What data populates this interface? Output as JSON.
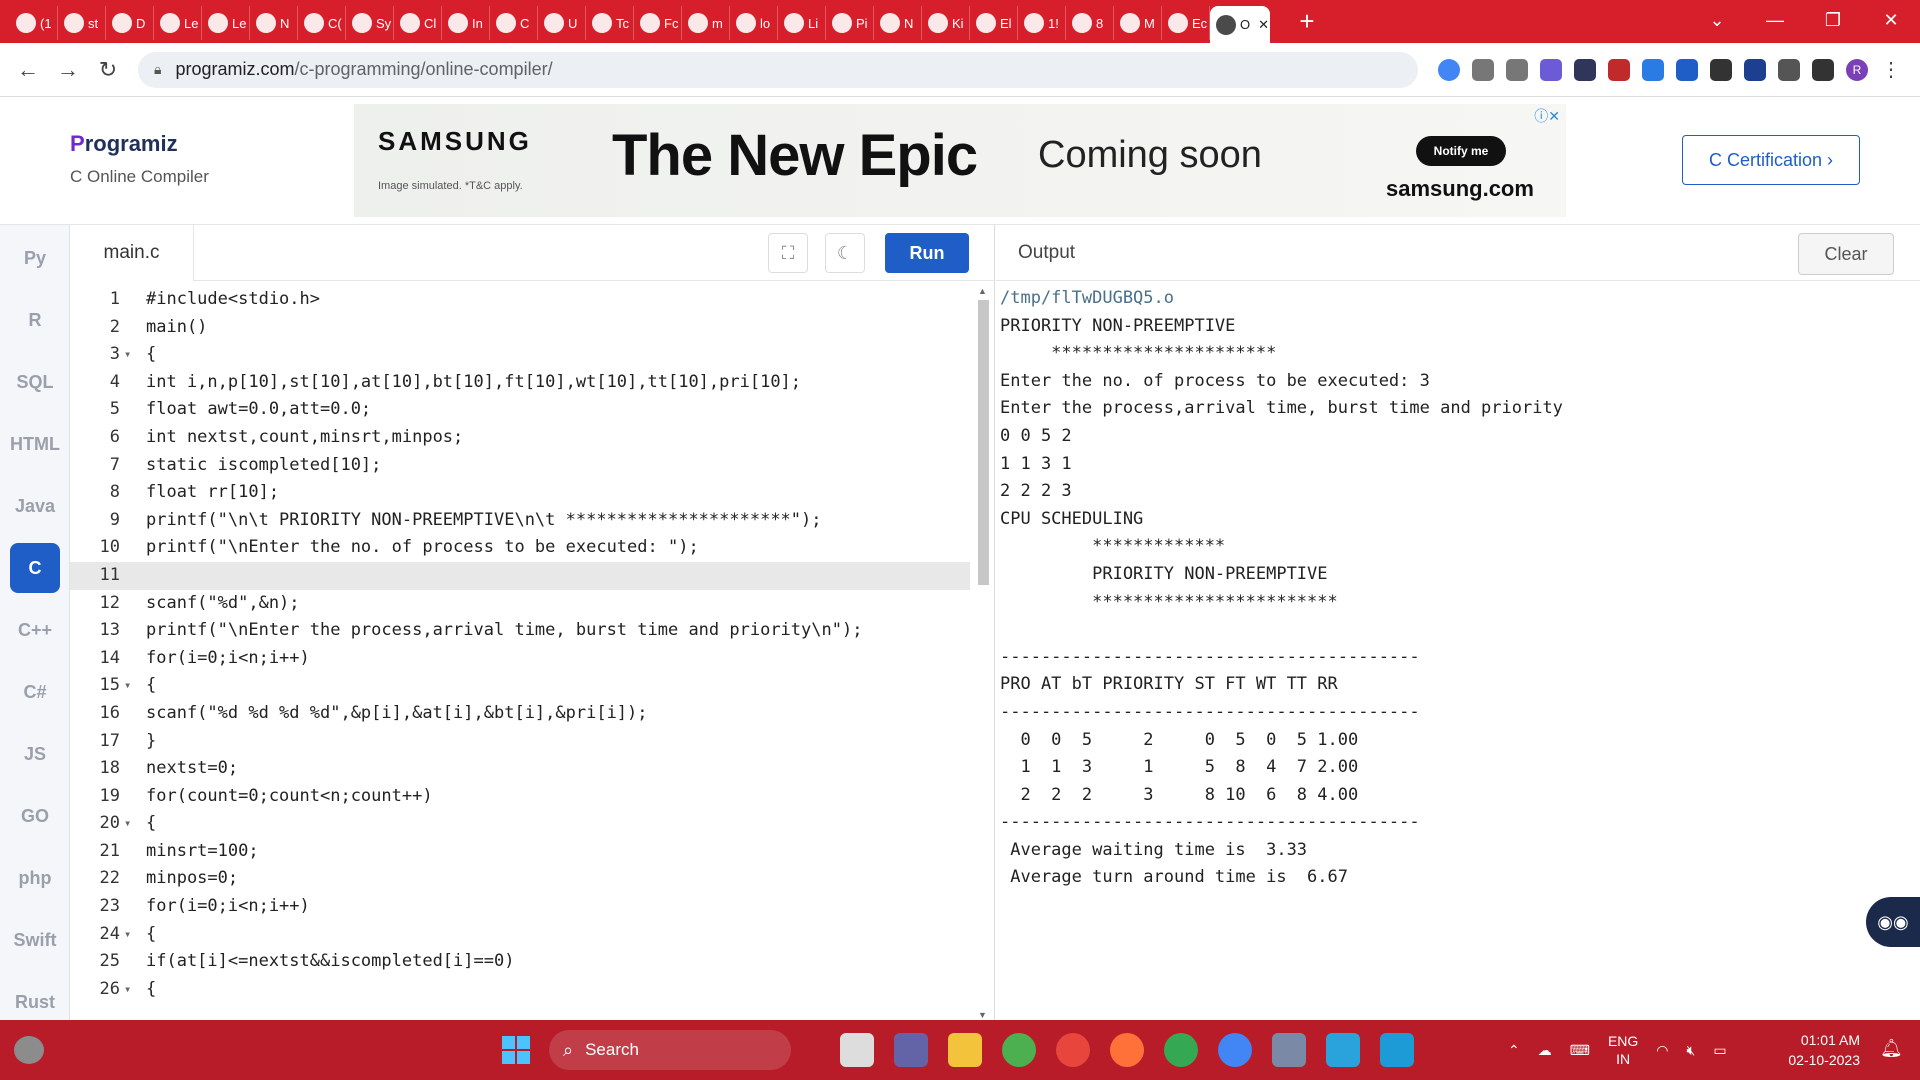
{
  "browser": {
    "tabs": [
      "(1",
      "st",
      "D",
      "Le",
      "Le",
      "N",
      "C(",
      "Sy",
      "Cl",
      "In",
      "C",
      "U",
      "Tc",
      "Fc",
      "m",
      "lo",
      "Li",
      "Pi",
      "N",
      "Ki",
      "El",
      "1!",
      "8",
      "M",
      "Ec",
      "O"
    ],
    "active_tab_close": "✕",
    "url_domain": "programiz.com",
    "url_path": "/c-programming/online-compiler/",
    "profile_initial": "R"
  },
  "header": {
    "logo_name": "rogramiz",
    "logo_p": "P",
    "logo_subtitle": "C Online Compiler",
    "certification_button": "C Certification ›"
  },
  "ad": {
    "brand": "SAMSUNG",
    "fine_print": "Image simulated. *T&C apply.",
    "headline": "The New Epic",
    "tagline": "Coming soon",
    "cta": "Notify me",
    "site": "samsung.com",
    "adchoices": "ⓘ✕"
  },
  "rail": {
    "items": [
      "Py",
      "R",
      "SQL",
      "HTML",
      "Java",
      "C",
      "C++",
      "C#",
      "JS",
      "GO",
      "php",
      "Swift",
      "Rust"
    ]
  },
  "editor": {
    "file_name": "main.c",
    "run_label": "Run",
    "lines": [
      {
        "n": "1",
        "fold": "",
        "text": "#include<stdio.h>"
      },
      {
        "n": "2",
        "fold": "",
        "text": "main()"
      },
      {
        "n": "3",
        "fold": "▾",
        "text": "{"
      },
      {
        "n": "4",
        "fold": "",
        "text": "int i,n,p[10],st[10],at[10],bt[10],ft[10],wt[10],tt[10],pri[10];"
      },
      {
        "n": "5",
        "fold": "",
        "text": "float awt=0.0,att=0.0;"
      },
      {
        "n": "6",
        "fold": "",
        "text": "int nextst,count,minsrt,minpos;"
      },
      {
        "n": "7",
        "fold": "",
        "text": "static iscompleted[10];"
      },
      {
        "n": "8",
        "fold": "",
        "text": "float rr[10];"
      },
      {
        "n": "9",
        "fold": "",
        "text": "printf(\"\\n\\t PRIORITY NON-PREEMPTIVE\\n\\t **********************\");"
      },
      {
        "n": "10",
        "fold": "",
        "text": "printf(\"\\nEnter the no. of process to be executed: \");"
      },
      {
        "n": "11",
        "fold": "",
        "text": ""
      },
      {
        "n": "12",
        "fold": "",
        "text": "scanf(\"%d\",&n);"
      },
      {
        "n": "13",
        "fold": "",
        "text": "printf(\"\\nEnter the process,arrival time, burst time and priority\\n\");"
      },
      {
        "n": "14",
        "fold": "",
        "text": "for(i=0;i<n;i++)"
      },
      {
        "n": "15",
        "fold": "▾",
        "text": "{"
      },
      {
        "n": "16",
        "fold": "",
        "text": "scanf(\"%d %d %d %d\",&p[i],&at[i],&bt[i],&pri[i]);"
      },
      {
        "n": "17",
        "fold": "",
        "text": "}"
      },
      {
        "n": "18",
        "fold": "",
        "text": "nextst=0;"
      },
      {
        "n": "19",
        "fold": "",
        "text": "for(count=0;count<n;count++)"
      },
      {
        "n": "20",
        "fold": "▾",
        "text": "{"
      },
      {
        "n": "21",
        "fold": "",
        "text": "minsrt=100;"
      },
      {
        "n": "22",
        "fold": "",
        "text": "minpos=0;"
      },
      {
        "n": "23",
        "fold": "",
        "text": "for(i=0;i<n;i++)"
      },
      {
        "n": "24",
        "fold": "▾",
        "text": "{"
      },
      {
        "n": "25",
        "fold": "",
        "text": "if(at[i]<=nextst&&iscompleted[i]==0)"
      },
      {
        "n": "26",
        "fold": "▾",
        "text": "{"
      }
    ],
    "current_line": "11"
  },
  "output": {
    "title": "Output",
    "clear_label": "Clear",
    "lines": [
      "/tmp/flTwDUGBQ5.o",
      "PRIORITY NON-PREEMPTIVE",
      "     **********************",
      "Enter the no. of process to be executed: 3",
      "Enter the process,arrival time, burst time and priority",
      "0 0 5 2",
      "1 1 3 1",
      "2 2 2 3",
      "CPU SCHEDULING",
      "         *************",
      "         PRIORITY NON-PREEMPTIVE",
      "         ************************",
      "",
      "-----------------------------------------",
      "PRO AT bT PRIORITY ST FT WT TT RR",
      "-----------------------------------------",
      "  0  0  5     2     0  5  0  5 1.00",
      "  1  1  3     1     5  8  4  7 2.00",
      "  2  2  2     3     8 10  6  8 4.00",
      "-----------------------------------------",
      " Average waiting time is  3.33",
      " Average turn around time is  6.67"
    ]
  },
  "taskbar": {
    "search_label": "Search",
    "lang_line1": "ENG",
    "lang_line2": "IN",
    "time": "01:01 AM",
    "date": "02-10-2023"
  },
  "colors": {
    "tabstrip": "#d71e2b",
    "taskbar": "#b71c28",
    "accent": "#1f5dc7"
  }
}
